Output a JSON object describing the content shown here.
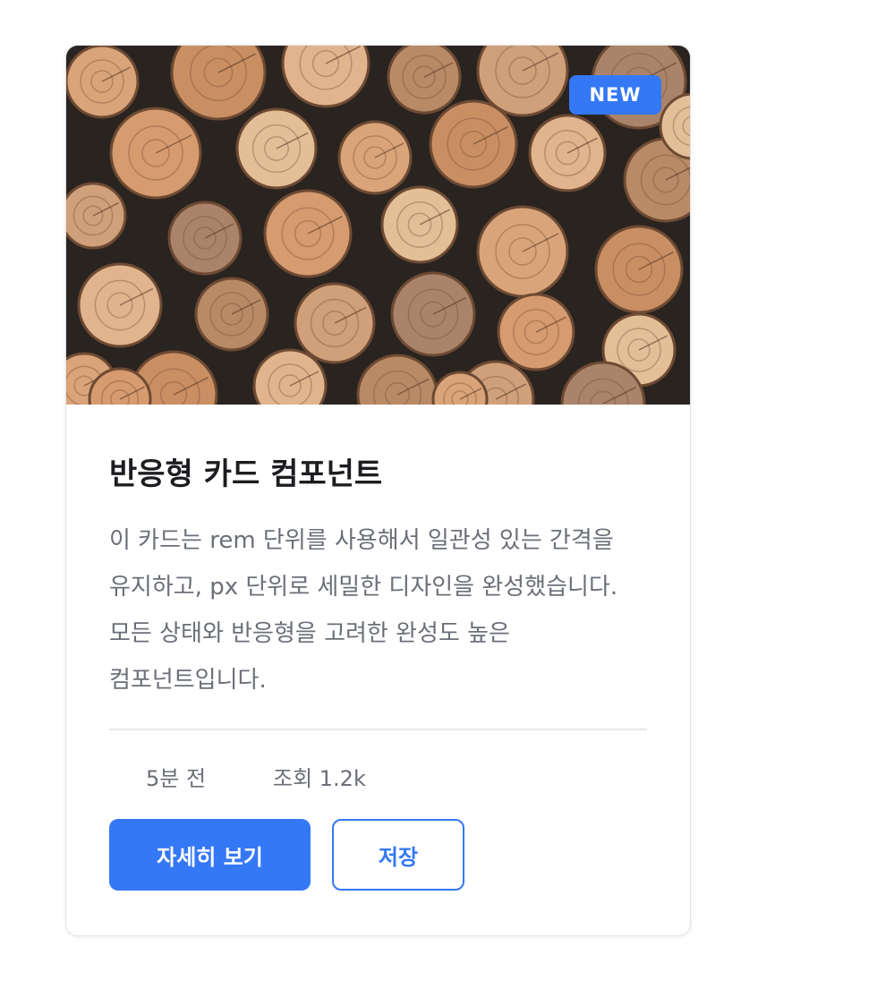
{
  "card": {
    "badge": "NEW",
    "image_alt": "stacked firewood logs",
    "title": "반응형 카드 컴포넌트",
    "description": "이 카드는 rem 단위를 사용해서 일관성 있는 간격을 유지하고, px 단위로 세밀한 디자인을 완성했습니다. 모든 상태와 반응형을 고려한 완성도 높은 컴포넌트입니다.",
    "meta": {
      "time": "5분 전",
      "views": "조회 1.2k"
    },
    "actions": {
      "primary_label": "자세히 보기",
      "secondary_label": "저장"
    }
  },
  "colors": {
    "accent": "#3478f6",
    "title": "#1c1d20",
    "muted": "#6b6f77"
  }
}
